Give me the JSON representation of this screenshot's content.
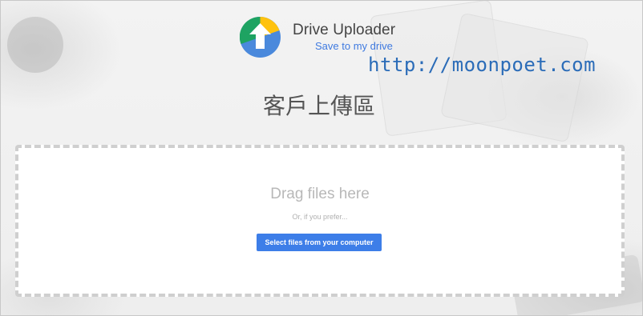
{
  "app": {
    "title": "Drive Uploader",
    "subtitle": "Save to my drive"
  },
  "watermark": {
    "text": "http://moonpoet.com"
  },
  "page": {
    "title": "客戶上傳區"
  },
  "dropzone": {
    "title": "Drag files here",
    "or_text": "Or, if you prefer...",
    "select_button_label": "Select files from your computer"
  },
  "colors": {
    "accent": "#3d7ee8",
    "subtitle": "#3f7ae0",
    "watermark": "#2b6cb8",
    "logo_green": "#1ea362",
    "logo_yellow": "#ffc20e",
    "logo_blue": "#4a89dc"
  },
  "icons": {
    "logo": "drive-uploader-logo-icon"
  }
}
